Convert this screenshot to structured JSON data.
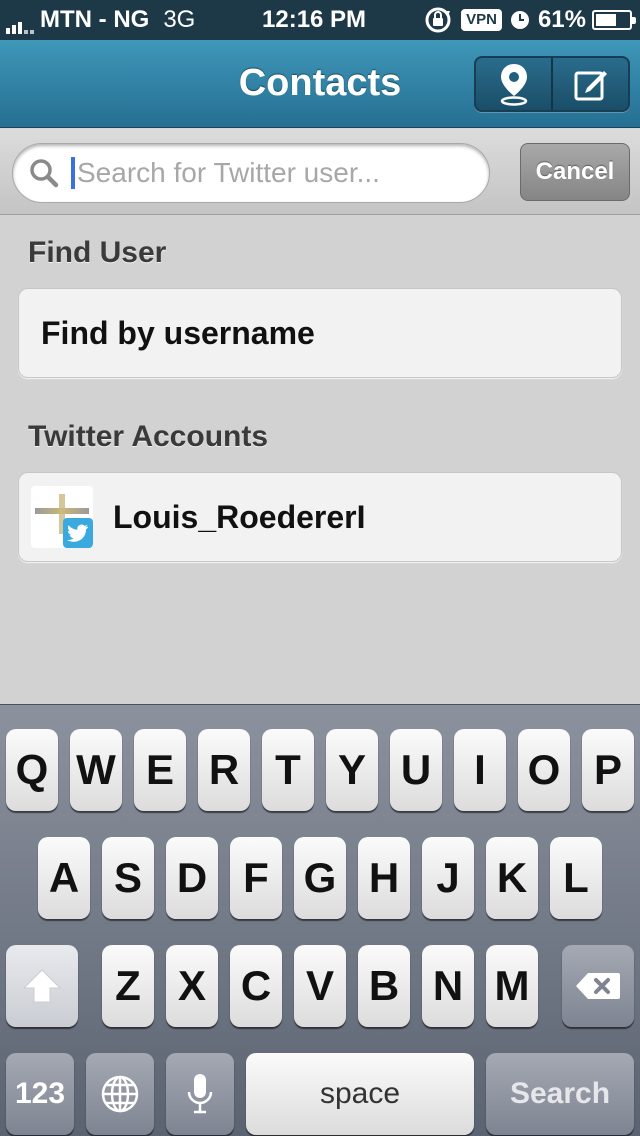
{
  "status_bar": {
    "carrier": "MTN - NG",
    "network": "3G",
    "time": "12:16 PM",
    "vpn": "VPN",
    "battery_percent": "61%",
    "battery_level": 0.61,
    "icons": [
      "signal-bars",
      "rotation-lock-icon",
      "vpn-badge",
      "alarm-clock-icon",
      "battery-icon"
    ]
  },
  "nav": {
    "title": "Contacts",
    "buttons": [
      {
        "name": "location-pin-icon"
      },
      {
        "name": "compose-icon"
      }
    ]
  },
  "search": {
    "placeholder": "Search for Twitter user...",
    "value": "",
    "cancel_label": "Cancel"
  },
  "sections": {
    "find_user": {
      "header": "Find User",
      "item": "Find by username"
    },
    "twitter_accounts": {
      "header": "Twitter Accounts",
      "item": "Louis_RoedererI"
    }
  },
  "keyboard": {
    "row1": [
      "Q",
      "W",
      "E",
      "R",
      "T",
      "Y",
      "U",
      "I",
      "O",
      "P"
    ],
    "row2": [
      "A",
      "S",
      "D",
      "F",
      "G",
      "H",
      "J",
      "K",
      "L"
    ],
    "row3": [
      "Z",
      "X",
      "C",
      "V",
      "B",
      "N",
      "M"
    ],
    "numbers_label": "123",
    "space_label": "space",
    "return_label": "Search",
    "special_icons": [
      "shift-icon",
      "backspace-icon",
      "globe-icon",
      "microphone-icon"
    ]
  },
  "colors": {
    "nav_top": "#3f97b9",
    "nav_bottom": "#256f92",
    "status_bar": "#1d3947",
    "twitter_blue": "#39a9e0"
  }
}
